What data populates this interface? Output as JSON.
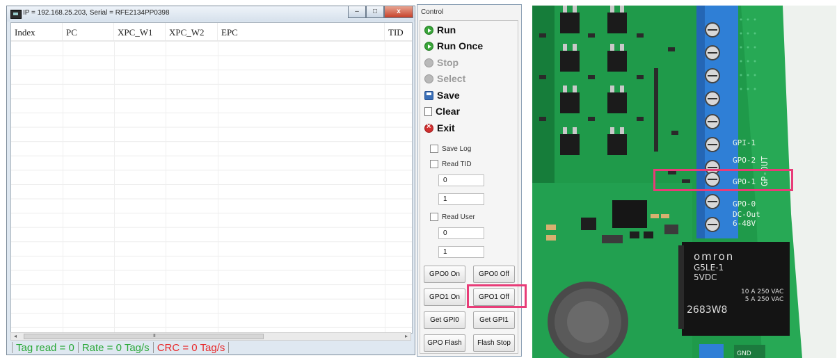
{
  "window": {
    "title": "IP = 192.168.25.203, Serial = RFE2134PP0398",
    "buttons": {
      "minimize": "–",
      "maximize": "□",
      "close": "x"
    }
  },
  "grid": {
    "columns": [
      "Index",
      "PC",
      "XPC_W1",
      "XPC_W2",
      "EPC",
      "TID"
    ]
  },
  "scrollbar": {
    "grip": "III",
    "left_arrow": "◂",
    "right_arrow": "▸"
  },
  "status": {
    "tag_read": "Tag read = 0",
    "rate": "Rate = 0 Tag/s",
    "crc": "CRC = 0 Tag/s"
  },
  "control": {
    "title": "Control",
    "commands": {
      "run": "Run",
      "run_once": "Run Once",
      "stop": "Stop",
      "select": "Select",
      "save": "Save",
      "clear": "Clear",
      "exit": "Exit"
    },
    "save_log": "Save Log",
    "read_tid": "Read TID",
    "tid_start": "0",
    "tid_len": "1",
    "read_user": "Read User",
    "user_start": "0",
    "user_len": "1",
    "buttons": {
      "gpo0_on": "GPO0 On",
      "gpo0_off": "GPO0 Off",
      "gpo1_on": "GPO1 On",
      "gpo1_off": "GPO1 Off",
      "get_gpi0": "Get GPI0",
      "get_gpi1": "Get GPI1",
      "gpo_flash": "GPO Flash",
      "flash_stop": "Flash Stop"
    }
  },
  "photo": {
    "relay_brand": "omron",
    "relay_model": "G5LE-1",
    "relay_voltage": "5VDC",
    "relay_rating1": "10 A 250 VAC",
    "relay_rating2": "5 A 250 VAC",
    "relay_code": "2683W8",
    "terminal_labels": [
      "GPI-1",
      "GPO-2",
      "GPO-1",
      "GPO-0",
      "DC-Out",
      "6-48V"
    ],
    "side_label": "GP-OUT",
    "gnd_label": "GND"
  },
  "colors": {
    "status_green": "#2aa838",
    "status_red": "#e8292a",
    "highlight": "#e83c78",
    "pcb_green": "#1f9a4a",
    "terminal_blue": "#2f7fd6"
  }
}
